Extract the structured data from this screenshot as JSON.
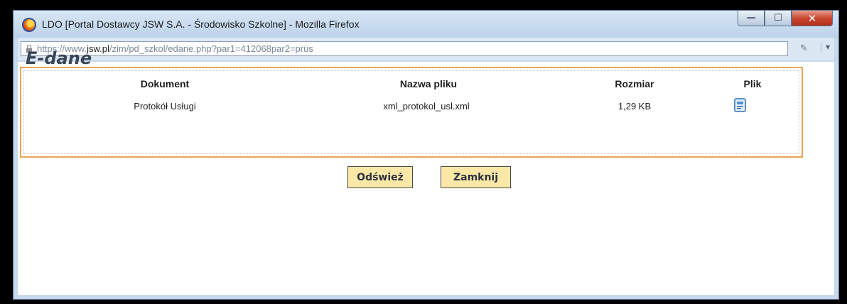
{
  "window": {
    "title": "LDO [Portal Dostawcy JSW S.A. - Środowisko Szkolne] - Mozilla Firefox",
    "controls": {
      "minimize": "—",
      "maximize": "☐",
      "close": "✕"
    }
  },
  "address_bar": {
    "url_prefix": "https://www.",
    "url_domain": "jsw.pl",
    "url_rest": "/zim/pd_szkol/edane.php?par1=412068par2=prus"
  },
  "page": {
    "title": "E-dane"
  },
  "table": {
    "headers": [
      "Dokument",
      "Nazwa pliku",
      "Rozmiar",
      "Plik"
    ],
    "rows": [
      {
        "document": "Protokół Usługi",
        "filename": "xml_protokol_usl.xml",
        "size": "1,29 KB",
        "file_icon": "document-icon"
      }
    ]
  },
  "buttons": {
    "refresh": "Odśwież",
    "close": "Zamknij"
  },
  "colors": {
    "panel_border": "#e8a655",
    "button_bg": "#fbe8a6",
    "close_button": "#c8412b"
  }
}
